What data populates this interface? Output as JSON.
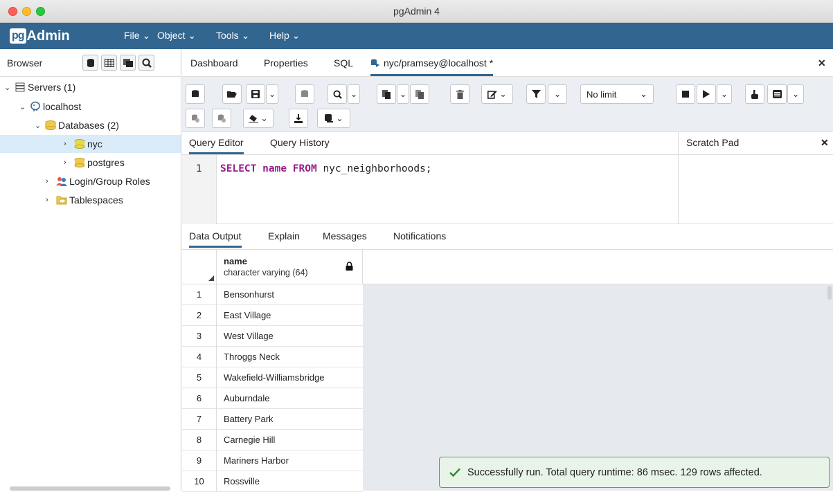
{
  "window": {
    "title": "pgAdmin 4"
  },
  "menubar": {
    "logo_pg": "pg",
    "logo_text": "Admin",
    "items": [
      {
        "label": "File ⌄"
      },
      {
        "label": "Object ⌄"
      },
      {
        "label": "Tools ⌄"
      },
      {
        "label": "Help ⌄"
      }
    ]
  },
  "browser": {
    "title": "Browser",
    "tree": {
      "servers": "Servers (1)",
      "localhost": "localhost",
      "databases": "Databases (2)",
      "nyc": "nyc",
      "postgres": "postgres",
      "login_roles": "Login/Group Roles",
      "tablespaces": "Tablespaces"
    }
  },
  "main_tabs": {
    "dashboard": "Dashboard",
    "properties": "Properties",
    "sql": "SQL",
    "query": "nyc/pramsey@localhost *",
    "close": "✕"
  },
  "toolbar": {
    "limit": "No limit"
  },
  "query_tabs": {
    "editor": "Query Editor",
    "history": "Query History"
  },
  "scratch_pad": {
    "title": "Scratch Pad",
    "close": "✕"
  },
  "editor": {
    "line": "1",
    "kw1": "SELECT",
    "col": "name",
    "kw2": "FROM",
    "table": "nyc_neighborhoods;"
  },
  "output_tabs": {
    "data": "Data Output",
    "explain": "Explain",
    "messages": "Messages",
    "notifications": "Notifications"
  },
  "grid": {
    "column_name": "name",
    "column_type": "character varying (64)",
    "rows": [
      {
        "num": "1",
        "value": "Bensonhurst"
      },
      {
        "num": "2",
        "value": "East Village"
      },
      {
        "num": "3",
        "value": "West Village"
      },
      {
        "num": "4",
        "value": "Throggs Neck"
      },
      {
        "num": "5",
        "value": "Wakefield-Williamsbridge"
      },
      {
        "num": "6",
        "value": "Auburndale"
      },
      {
        "num": "7",
        "value": "Battery Park"
      },
      {
        "num": "8",
        "value": "Carnegie Hill"
      },
      {
        "num": "9",
        "value": "Mariners Harbor"
      },
      {
        "num": "10",
        "value": "Rossville"
      }
    ]
  },
  "status": {
    "message": "Successfully run. Total query runtime: 86 msec. 129 rows affected."
  }
}
